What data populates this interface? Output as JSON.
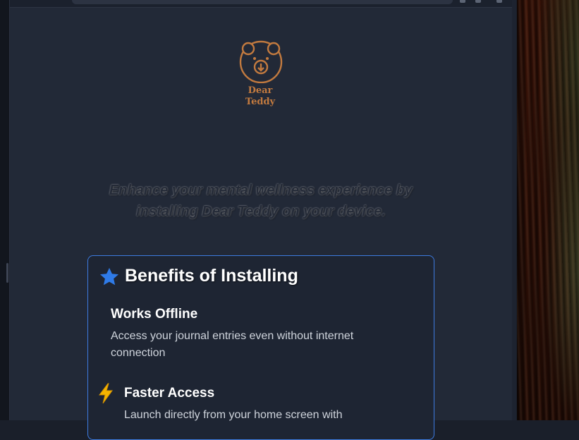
{
  "logo": {
    "line1": "Dear",
    "line2": "Teddy",
    "color": "#c27a3f"
  },
  "tagline": "Enhance your mental wellness experience by installing Dear Teddy on your device.",
  "benefits_card": {
    "title": "Benefits of Installing",
    "title_icon": "star-icon",
    "accent": "#3d7be0",
    "items": [
      {
        "title": "Works Offline",
        "description": "Access your journal entries even without internet connection"
      },
      {
        "icon": "bolt-icon",
        "title": "Faster Access",
        "description": "Launch directly from your home screen with"
      }
    ]
  }
}
